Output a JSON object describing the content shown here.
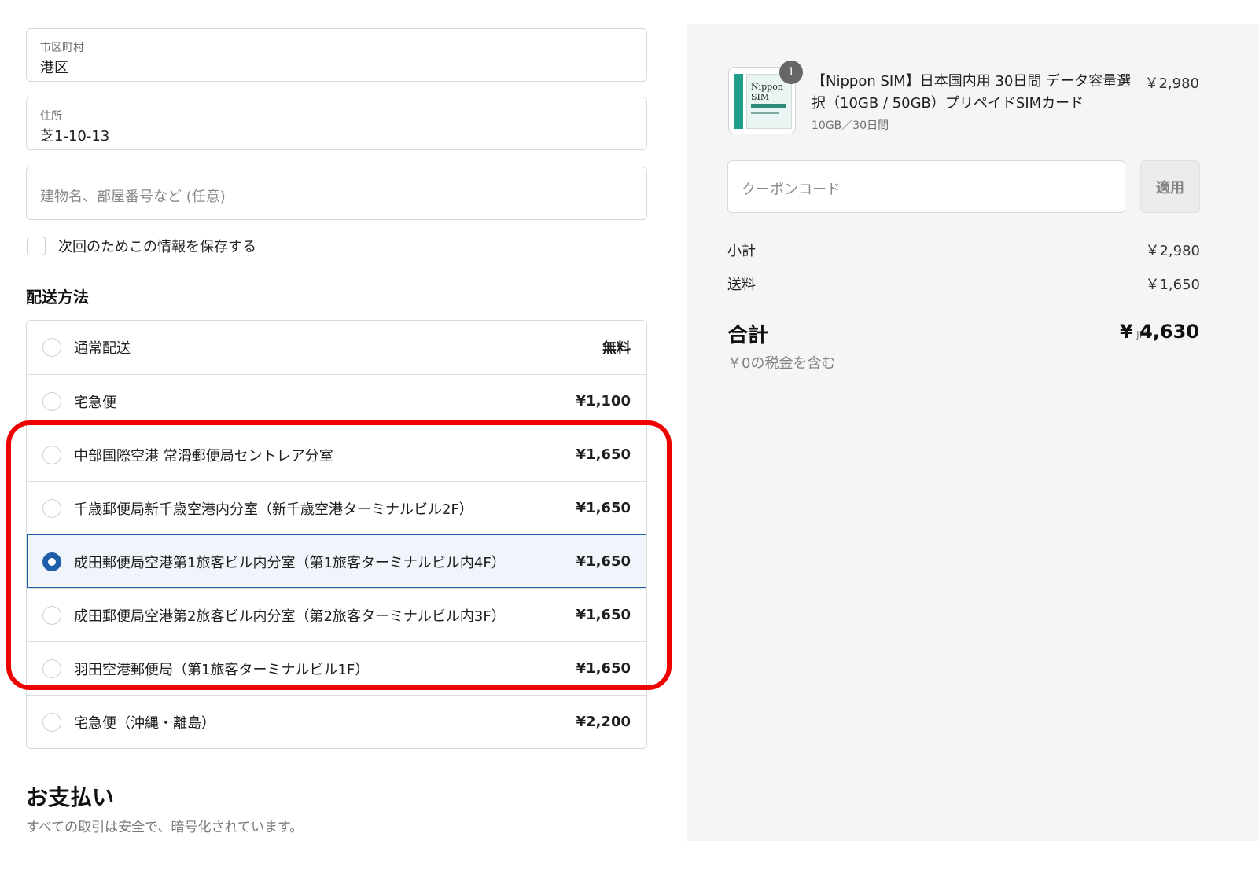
{
  "address": {
    "city": {
      "label": "市区町村",
      "value": "港区"
    },
    "street": {
      "label": "住所",
      "value": "芝1-10-13"
    },
    "building": {
      "placeholder": "建物名、部屋番号など (任意)"
    },
    "save_info_label": "次回のためこの情報を保存する"
  },
  "shipping": {
    "title": "配送方法",
    "options": [
      {
        "name": "通常配送",
        "price": "無料",
        "selected": false
      },
      {
        "name": "宅急便",
        "price": "¥1,100",
        "selected": false
      },
      {
        "name": "中部国際空港 常滑郵便局セントレア分室",
        "price": "¥1,650",
        "selected": false
      },
      {
        "name": "千歳郵便局新千歳空港内分室（新千歳空港ターミナルビル2F）",
        "price": "¥1,650",
        "selected": false
      },
      {
        "name": "成田郵便局空港第1旅客ビル内分室（第1旅客ターミナルビル内4F）",
        "price": "¥1,650",
        "selected": true
      },
      {
        "name": "成田郵便局空港第2旅客ビル内分室（第2旅客ターミナルビル内3F）",
        "price": "¥1,650",
        "selected": false
      },
      {
        "name": "羽田空港郵便局（第1旅客ターミナルビル1F）",
        "price": "¥1,650",
        "selected": false
      },
      {
        "name": "宅急便（沖縄・離島）",
        "price": "¥2,200",
        "selected": false
      }
    ]
  },
  "payment": {
    "title": "お支払い",
    "subtitle": "すべての取引は安全で、暗号化されています。"
  },
  "order": {
    "product": {
      "quantity": "1",
      "title": "【Nippon SIM】日本国内用 30日間 データ容量選択（10GB / 50GB）プリペイドSIMカード",
      "variant": "10GB／30日間",
      "price": "￥2,980",
      "thumb_brand": "Nippon SIM"
    },
    "coupon": {
      "placeholder": "クーポンコード",
      "apply_label": "適用"
    },
    "subtotal": {
      "label": "小計",
      "value": "￥2,980"
    },
    "shipping_cost": {
      "label": "送料",
      "value": "￥1,650"
    },
    "total": {
      "label": "合計",
      "currency": "JPY",
      "value": "¥ 4,630"
    },
    "tax_note": "￥0の税金を含む"
  },
  "colors": {
    "accent": "#1f5ea8",
    "highlight": "#ee0000"
  }
}
